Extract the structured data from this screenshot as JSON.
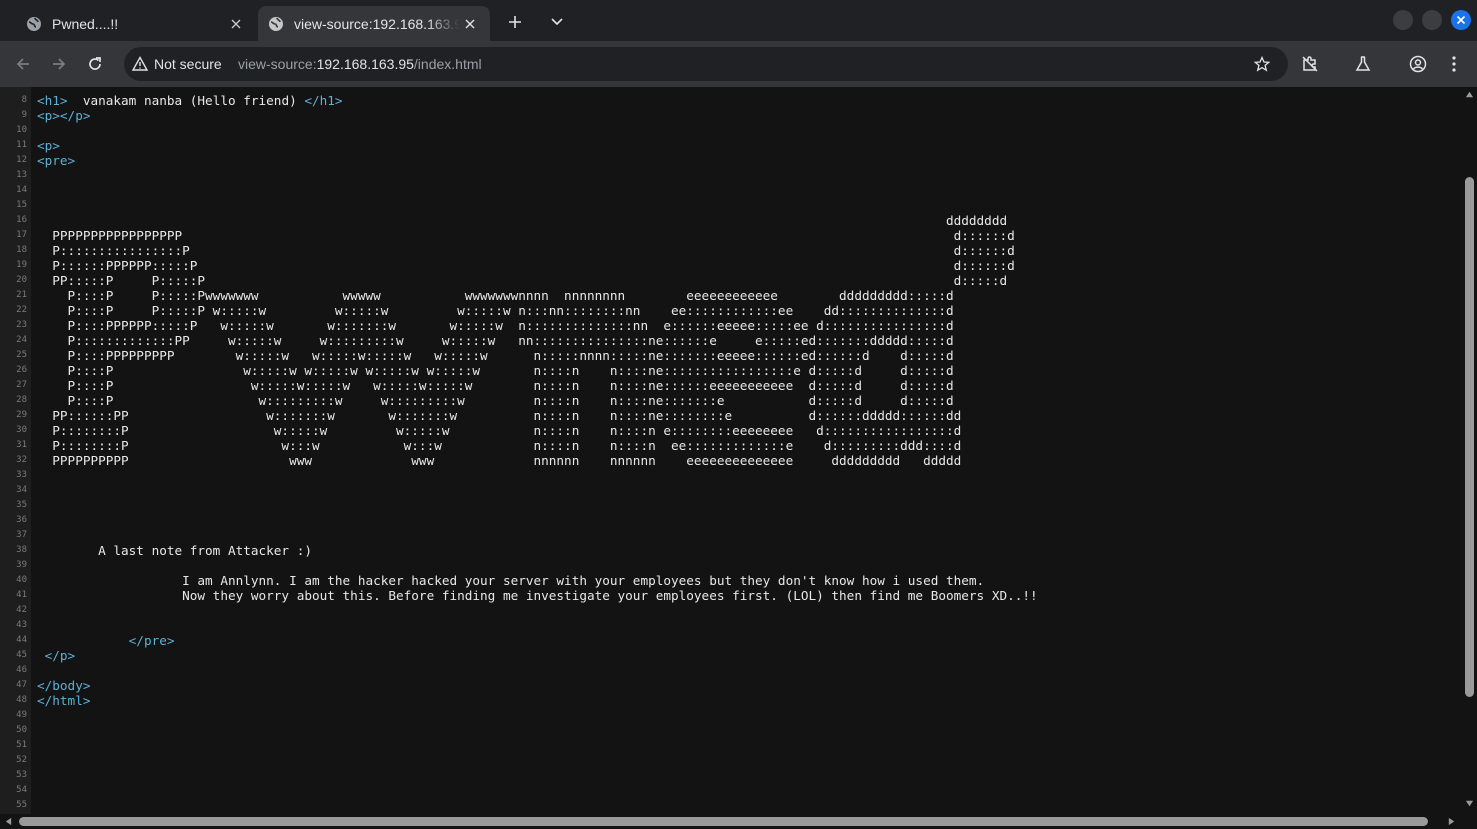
{
  "browser": {
    "tabs": [
      {
        "title": "Pwned....!!",
        "active": false
      },
      {
        "title": "view-source:192.168.163.95/index.html",
        "active": true
      }
    ],
    "security_label": "Not secure",
    "url_prefix": "view-source:",
    "url_host": "192.168.163.95",
    "url_path": "/index.html",
    "colors": {
      "tag": "#5db0d7",
      "text": "#e8e8e8",
      "background": "#131313",
      "accent": "#1a73e8"
    }
  },
  "source_lines": [
    {
      "n": "8",
      "segs": [
        {
          "t": "<h1>",
          "tag": true
        },
        {
          "t": "  vanakam nanba (Hello friend) "
        },
        {
          "t": "</h1>",
          "tag": true
        }
      ]
    },
    {
      "n": "9",
      "segs": [
        {
          "t": "<p></p>",
          "tag": true
        }
      ]
    },
    {
      "n": "10",
      "segs": []
    },
    {
      "n": "11",
      "segs": [
        {
          "t": "<p>",
          "tag": true
        }
      ]
    },
    {
      "n": "12",
      "segs": [
        {
          "t": "<pre>",
          "tag": true
        }
      ]
    },
    {
      "n": "13",
      "segs": []
    },
    {
      "n": "14",
      "segs": []
    },
    {
      "n": "15",
      "segs": []
    },
    {
      "n": "16",
      "segs": [
        {
          "t": "                                                                                                                       dddddddd"
        }
      ]
    },
    {
      "n": "17",
      "segs": [
        {
          "t": "  PPPPPPPPPPPPPPPPP                                                                                                     d::::::d"
        }
      ]
    },
    {
      "n": "18",
      "segs": [
        {
          "t": "  P::::::::::::::::P                                                                                                    d::::::d"
        }
      ]
    },
    {
      "n": "19",
      "segs": [
        {
          "t": "  P::::::PPPPPP:::::P                                                                                                   d::::::d"
        }
      ]
    },
    {
      "n": "20",
      "segs": [
        {
          "t": "  PP:::::P     P:::::P                                                                                                  d:::::d"
        }
      ]
    },
    {
      "n": "21",
      "segs": [
        {
          "t": "    P::::P     P:::::Pwwwwwww           wwwww           wwwwwwwnnnn  nnnnnnnn        eeeeeeeeeeee        ddddddddd:::::d"
        }
      ]
    },
    {
      "n": "22",
      "segs": [
        {
          "t": "    P::::P     P:::::P w:::::w         w:::::w         w:::::w n:::nn::::::::nn    ee::::::::::::ee    dd::::::::::::::d"
        }
      ]
    },
    {
      "n": "23",
      "segs": [
        {
          "t": "    P::::PPPPPP:::::P   w:::::w       w:::::::w       w:::::w  n::::::::::::::nn  e::::::eeeee:::::ee d::::::::::::::::d"
        }
      ]
    },
    {
      "n": "24",
      "segs": [
        {
          "t": "    P:::::::::::::PP     w:::::w     w:::::::::w     w:::::w   nn:::::::::::::::ne::::::e     e:::::ed:::::::ddddd:::::d"
        }
      ]
    },
    {
      "n": "25",
      "segs": [
        {
          "t": "    P::::PPPPPPPPP        w:::::w   w:::::w:::::w   w:::::w      n:::::nnnn:::::ne:::::::eeeee::::::ed::::::d    d:::::d"
        }
      ]
    },
    {
      "n": "26",
      "segs": [
        {
          "t": "    P::::P                 w:::::w w:::::w w:::::w w:::::w       n::::n    n::::ne:::::::::::::::::e d:::::d     d:::::d"
        }
      ]
    },
    {
      "n": "27",
      "segs": [
        {
          "t": "    P::::P                  w:::::w:::::w   w:::::w:::::w        n::::n    n::::ne::::::eeeeeeeeeee  d:::::d     d:::::d"
        }
      ]
    },
    {
      "n": "28",
      "segs": [
        {
          "t": "    P::::P                   w:::::::::w     w:::::::::w         n::::n    n::::ne:::::::e           d:::::d     d:::::d"
        }
      ]
    },
    {
      "n": "29",
      "segs": [
        {
          "t": "  PP::::::PP                  w:::::::w       w:::::::w          n::::n    n::::ne::::::::e          d::::::ddddd::::::dd"
        }
      ]
    },
    {
      "n": "30",
      "segs": [
        {
          "t": "  P::::::::P                   w:::::w         w:::::w           n::::n    n::::n e::::::::eeeeeeee   d:::::::::::::::::d"
        }
      ]
    },
    {
      "n": "31",
      "segs": [
        {
          "t": "  P::::::::P                    w:::w           w:::w            n::::n    n::::n  ee:::::::::::::e    d:::::::::ddd::::d"
        }
      ]
    },
    {
      "n": "32",
      "segs": [
        {
          "t": "  PPPPPPPPPP                     www             www             nnnnnn    nnnnnn    eeeeeeeeeeeeee     ddddddddd   ddddd"
        }
      ]
    },
    {
      "n": "33",
      "segs": []
    },
    {
      "n": "34",
      "segs": []
    },
    {
      "n": "35",
      "segs": []
    },
    {
      "n": "36",
      "segs": []
    },
    {
      "n": "37",
      "segs": []
    },
    {
      "n": "38",
      "segs": [
        {
          "t": "        A last note from Attacker :)"
        }
      ]
    },
    {
      "n": "39",
      "segs": []
    },
    {
      "n": "40",
      "segs": [
        {
          "t": "                   I am Annlynn. I am the hacker hacked your server with your employees but they don't know how i used them."
        }
      ]
    },
    {
      "n": "41",
      "segs": [
        {
          "t": "                   Now they worry about this. Before finding me investigate your employees first. (LOL) then find me Boomers XD..!!"
        }
      ]
    },
    {
      "n": "42",
      "segs": []
    },
    {
      "n": "43",
      "segs": []
    },
    {
      "n": "44",
      "segs": [
        {
          "t": "            "
        },
        {
          "t": "</pre>",
          "tag": true
        }
      ]
    },
    {
      "n": "45",
      "segs": [
        {
          "t": " "
        },
        {
          "t": "</p>",
          "tag": true
        }
      ]
    },
    {
      "n": "46",
      "segs": []
    },
    {
      "n": "47",
      "segs": [
        {
          "t": "</body>",
          "tag": true
        }
      ]
    },
    {
      "n": "48",
      "segs": [
        {
          "t": "</html>",
          "tag": true
        }
      ]
    },
    {
      "n": "49",
      "segs": []
    },
    {
      "n": "50",
      "segs": []
    },
    {
      "n": "51",
      "segs": []
    },
    {
      "n": "52",
      "segs": []
    },
    {
      "n": "53",
      "segs": []
    },
    {
      "n": "54",
      "segs": []
    },
    {
      "n": "55",
      "segs": []
    }
  ]
}
